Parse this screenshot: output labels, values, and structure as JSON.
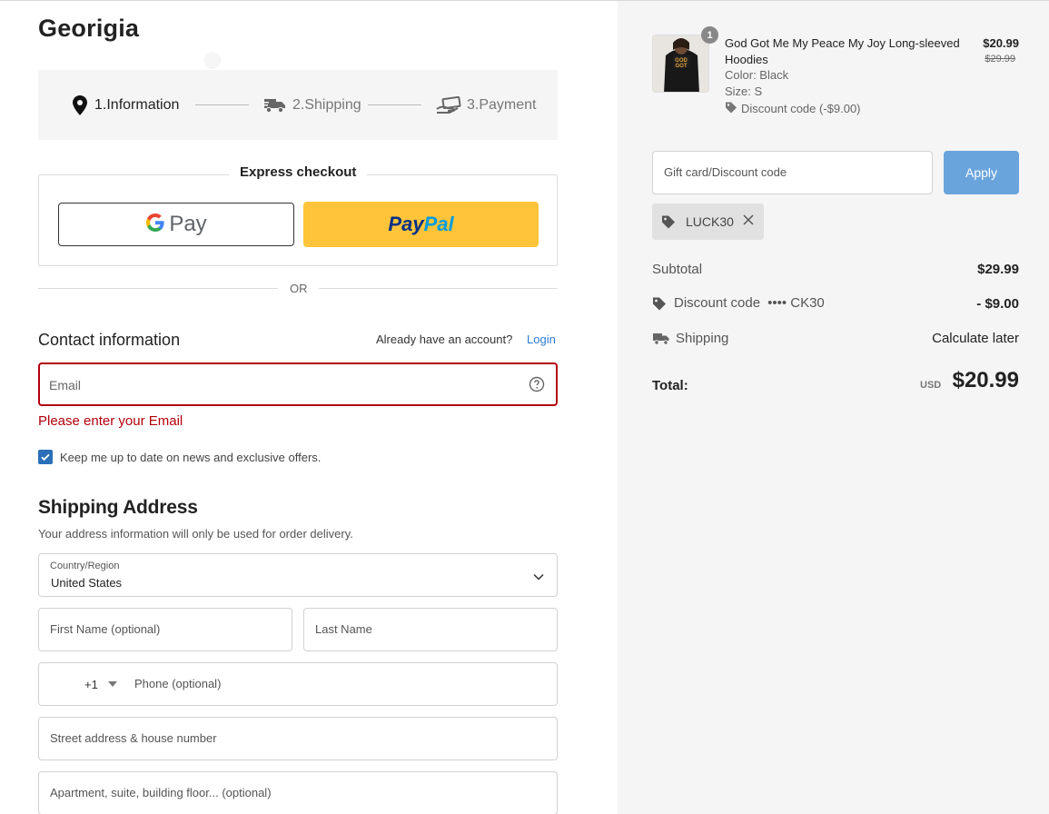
{
  "store": {
    "title": "Georigia"
  },
  "steps": [
    {
      "label": "1.Information",
      "icon": "location-pin-icon",
      "state": "active"
    },
    {
      "label": "2.Shipping",
      "icon": "truck-icon",
      "state": "pending"
    },
    {
      "label": "3.Payment",
      "icon": "hand-card-icon",
      "state": "pending"
    }
  ],
  "express": {
    "title": "Express checkout",
    "gpay_label": "Pay",
    "paypal_label_a": "Pay",
    "paypal_label_b": "Pal",
    "or_text": "OR"
  },
  "contact": {
    "title": "Contact information",
    "account_question": "Already have an account?",
    "login_label": "Login",
    "email_placeholder": "Email",
    "email_value": "",
    "email_error": "Please enter your Email",
    "newsletter_label": "Keep me up to date on news and exclusive offers.",
    "newsletter_checked": true
  },
  "shipping_address": {
    "title": "Shipping Address",
    "subtitle": "Your address information will only be used for order delivery.",
    "country_label": "Country/Region",
    "country_value": "United States",
    "first_name_placeholder": "First Name (optional)",
    "last_name_placeholder": "Last Name",
    "phone_code": "+1",
    "phone_placeholder": "Phone (optional)",
    "street_placeholder": "Street address & house number",
    "apartment_placeholder": "Apartment, suite, building floor... (optional)"
  },
  "order": {
    "item": {
      "quantity": "1",
      "name": "God Got Me My Peace My Joy Long-sleeved Hoodies",
      "color": "Color: Black",
      "size": "Size: S",
      "discount": "Discount code (-$9.00)",
      "price": "$20.99",
      "original_price": "$29.99",
      "thumb_text": "GOD GOT"
    },
    "gift_placeholder": "Gift card/Discount code",
    "apply_label": "Apply",
    "applied_code": "LUCK30",
    "subtotal_label": "Subtotal",
    "subtotal_value": "$29.99",
    "discount_label": "Discount code",
    "discount_code_masked": "•••• CK30",
    "discount_value": "- $9.00",
    "shipping_label": "Shipping",
    "shipping_value": "Calculate later",
    "total_label": "Total:",
    "total_currency": "USD",
    "total_value": "$20.99"
  },
  "colors": {
    "error": "#b3000c",
    "link": "#2a7bd3",
    "apply_button": "#6aa4dc",
    "paypal_yellow": "#ffc439",
    "checkbox": "#2a6fb8"
  }
}
